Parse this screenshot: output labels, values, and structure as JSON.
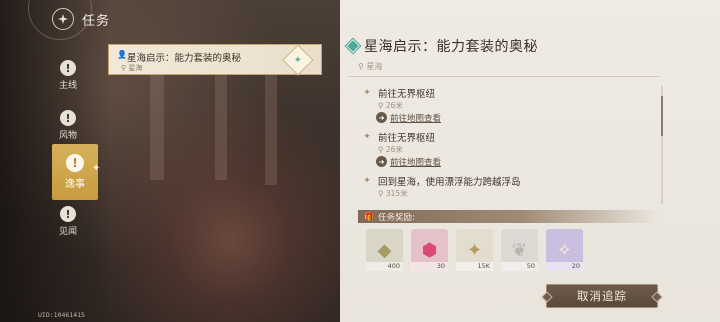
{
  "nav": {
    "title": "任务",
    "items": [
      {
        "label": "主线",
        "icon": "exclamation-icon"
      },
      {
        "label": "风物",
        "icon": "exclamation-icon"
      },
      {
        "label": "逸事",
        "icon": "exclamation-icon",
        "active": true
      },
      {
        "label": "见闻",
        "icon": "exclamation-icon"
      }
    ]
  },
  "quest_list": {
    "selected": {
      "name": "星海启示：能力套装的奥秘",
      "location": "星海"
    }
  },
  "detail": {
    "title": "星海启示：能力套装的奥秘",
    "location": "星海",
    "steps": [
      {
        "title": "前往无界枢纽",
        "distance": "26米",
        "map_link": "前往地图查看"
      },
      {
        "title": "前往无界枢纽",
        "distance": "26米",
        "map_link": "前往地图查看"
      },
      {
        "title": "回到星海，使用漂浮能力跨越浮岛",
        "distance": "315米"
      }
    ],
    "rewards_label": "任务奖励:",
    "rewards": [
      {
        "icon": "gem-icon",
        "qty": "400",
        "color": "#d9d6c8"
      },
      {
        "icon": "crystal-icon",
        "qty": "30",
        "color": "#e7c1c9"
      },
      {
        "icon": "star-icon",
        "qty": "15K",
        "color": "#e3ddd0"
      },
      {
        "icon": "bow-icon",
        "qty": "50",
        "color": "#dcd9d4"
      },
      {
        "icon": "sparkle-icon",
        "qty": "20",
        "color": "#c9bde0"
      }
    ],
    "cancel_label": "取消追踪"
  },
  "uid": "UID:10461415"
}
